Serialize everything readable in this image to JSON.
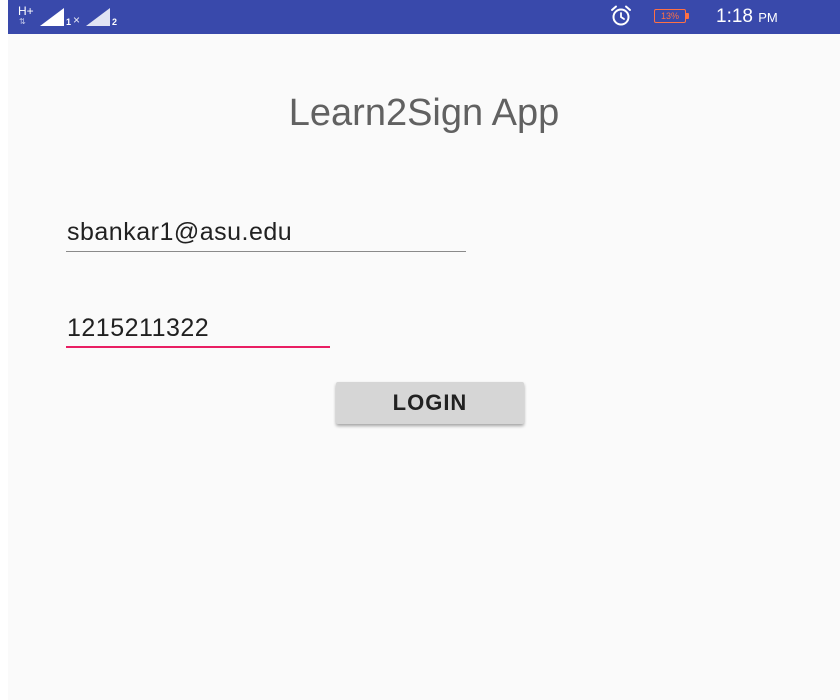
{
  "status_bar": {
    "network_type": "H+",
    "network_arrows": "⇅",
    "sim1_label": "1",
    "no_connection_mark": "×",
    "sim2_label": "2",
    "alarm_icon": "alarm-clock-icon",
    "battery_level": "13%",
    "time": "1:18",
    "ampm": "PM",
    "color": "#3949ab"
  },
  "app": {
    "title": "Learn2Sign App"
  },
  "form": {
    "email_value": "sbankar1@asu.edu",
    "password_value": "1215211322",
    "login_label": "LOGIN",
    "accent_color": "#e91e63"
  }
}
